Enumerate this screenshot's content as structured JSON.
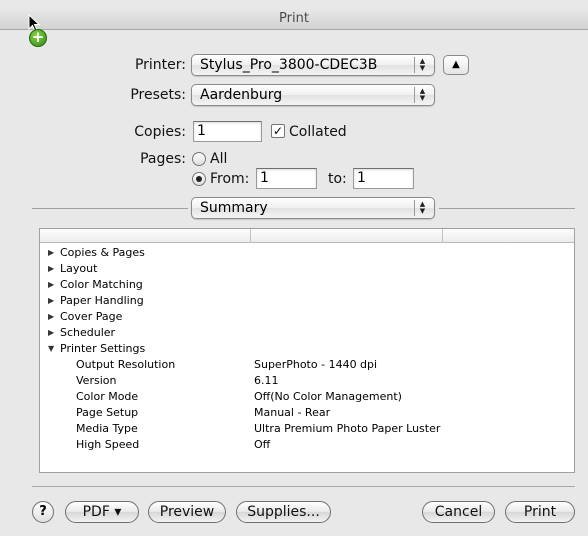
{
  "window": {
    "title": "Print"
  },
  "printer": {
    "label": "Printer:",
    "value": "Stylus_Pro_3800-CDEC3B"
  },
  "presets": {
    "label": "Presets:",
    "value": "Aardenburg"
  },
  "copies": {
    "label": "Copies:",
    "value": "1",
    "collated_label": "Collated",
    "collated": true
  },
  "pages": {
    "label": "Pages:",
    "all_label": "All",
    "from_label": "From:",
    "from_value": "1",
    "to_label": "to:",
    "to_value": "1",
    "selected": "from"
  },
  "panel": {
    "value": "Summary"
  },
  "summary": {
    "sections": [
      {
        "name": "Copies & Pages",
        "expanded": false
      },
      {
        "name": "Layout",
        "expanded": false
      },
      {
        "name": "Color Matching",
        "expanded": false
      },
      {
        "name": "Paper Handling",
        "expanded": false
      },
      {
        "name": "Cover Page",
        "expanded": false
      },
      {
        "name": "Scheduler",
        "expanded": false
      },
      {
        "name": "Printer Settings",
        "expanded": true
      }
    ],
    "printer_settings": [
      {
        "name": "Output Resolution",
        "value": "SuperPhoto - 1440 dpi"
      },
      {
        "name": "Version",
        "value": "6.11"
      },
      {
        "name": "Color Mode",
        "value": "Off(No Color Management)"
      },
      {
        "name": "Page Setup",
        "value": "Manual - Rear"
      },
      {
        "name": "Media Type",
        "value": "Ultra Premium Photo Paper Luster"
      },
      {
        "name": "High Speed",
        "value": "Off"
      }
    ]
  },
  "buttons": {
    "help": "?",
    "pdf": "PDF ▾",
    "preview": "Preview",
    "supplies": "Supplies...",
    "cancel": "Cancel",
    "print": "Print"
  },
  "icons": {
    "cursor": "arrow-cursor-icon",
    "copy_badge": "plus-badge-icon",
    "popup_arrows": "updown-arrows-icon",
    "disclosure": "triangle-up-icon",
    "collapsed": "triangle-right-icon",
    "expanded": "triangle-down-icon"
  }
}
